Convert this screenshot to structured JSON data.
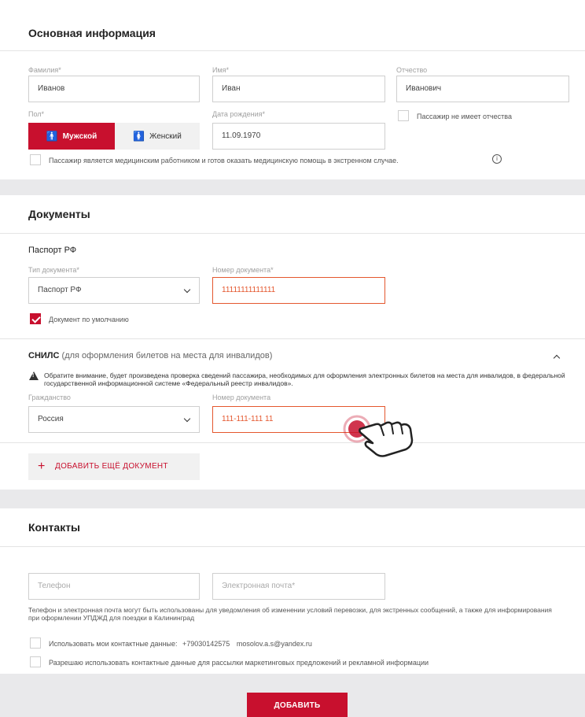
{
  "basic": {
    "title": "Основная информация",
    "surname_label": "Фамилия*",
    "surname_value": "Иванов",
    "name_label": "Имя*",
    "name_value": "Иван",
    "patronymic_label": "Отчество",
    "patronymic_value": "Иванович",
    "gender_label": "Пол*",
    "gender_male": "Мужской",
    "gender_female": "Женский",
    "birthdate_label": "Дата рождения*",
    "birthdate_value": "11.09.1970",
    "no_patronymic": "Пассажир не имеет отчества",
    "medical": "Пассажир является медицинским работником и готов оказать медицинскую помощь в экстренном случае."
  },
  "documents": {
    "title": "Документы",
    "passport_title": "Паспорт РФ",
    "doc_type_label": "Тип документа*",
    "doc_type_value": "Паспорт РФ",
    "doc_number_label": "Номер документа*",
    "doc_number_value": "11111111111111",
    "default_doc": "Документ по умолчанию",
    "snils_title": "СНИЛС",
    "snils_sub": "(для оформления билетов на места для инвалидов)",
    "snils_warning": "Обратите внимание, будет произведена проверка сведений пассажира, необходимых для оформления электронных билетов на места для инвалидов, в федеральной государственной информационной системе «Федеральный реестр инвалидов».",
    "citizenship_label": "Гражданство",
    "citizenship_value": "Россия",
    "snils_number_label": "Номер документа",
    "snils_number_value": "111-111-111 11",
    "add_doc": "ДОБАВИТЬ ЕЩЁ ДОКУМЕНТ"
  },
  "contacts": {
    "title": "Контакты",
    "phone_placeholder": "Телефон",
    "email_placeholder": "Электронная почта*",
    "note": "Телефон и электронная почта могут быть использованы для уведомления об изменении условий перевозки, для экстренных сообщений, а также для информирования при оформлении УПДЖД для поездки в Калининград",
    "use_my_contacts": "Использовать мои контактные данные:",
    "my_phone": "+79030142575",
    "my_email": "mosolov.a.s@yandex.ru",
    "marketing": "Разрешаю использовать контактные данные для рассылки маркетинговых предложений и рекламной информации"
  },
  "submit_label": "ДОБАВИТЬ",
  "colors": {
    "accent": "#c8102e",
    "error": "#e4572e",
    "band": "#e9e9eb"
  }
}
